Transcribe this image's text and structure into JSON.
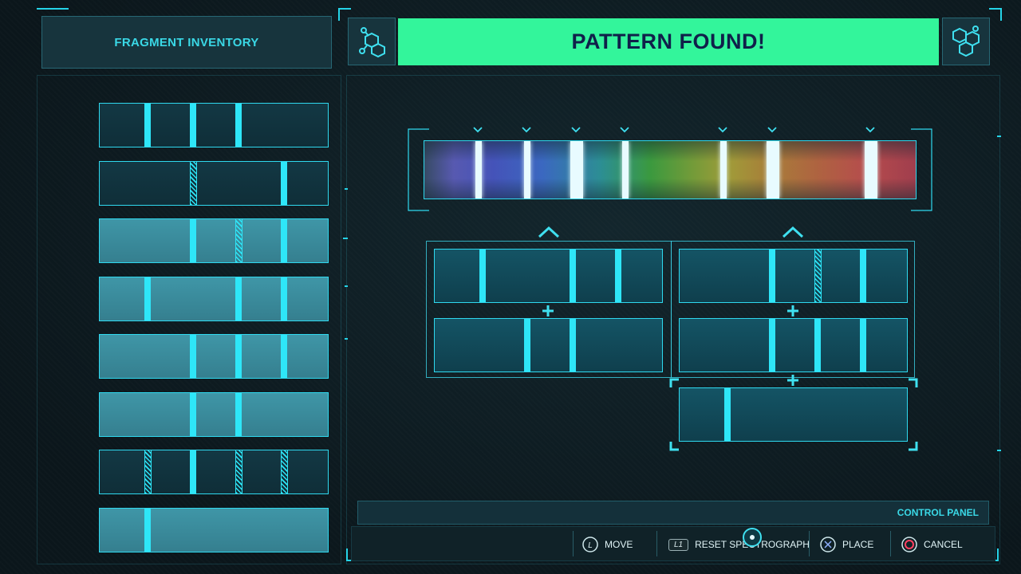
{
  "inventory": {
    "title": "FRAGMENT INVENTORY",
    "fragments": [
      {
        "style": "dim",
        "bands": [
          0.21,
          0.41,
          0.61
        ],
        "ghosts": [],
        "dividers": []
      },
      {
        "style": "dim",
        "bands": [
          0.81
        ],
        "ghosts": [
          0.41
        ],
        "dividers": []
      },
      {
        "style": "lit",
        "bands": [
          0.41,
          0.81
        ],
        "ghosts": [
          0.61
        ],
        "dividers": []
      },
      {
        "style": "lit",
        "bands": [
          0.21,
          0.61,
          0.81
        ],
        "ghosts": [],
        "dividers": []
      },
      {
        "style": "lit",
        "bands": [
          0.41,
          0.61,
          0.81
        ],
        "ghosts": [],
        "dividers": []
      },
      {
        "style": "lit",
        "bands": [
          0.41,
          0.61
        ],
        "ghosts": [],
        "dividers": []
      },
      {
        "style": "dim",
        "bands": [
          0.41
        ],
        "ghosts": [
          0.21,
          0.61,
          0.81
        ],
        "dividers": []
      },
      {
        "style": "lit",
        "bands": [
          0.21
        ],
        "ghosts": [],
        "dividers": []
      }
    ]
  },
  "banner": {
    "text": "PATTERN FOUND!",
    "color": "#33f59b"
  },
  "icons": {
    "left": "molecule-icon",
    "right": "molecule-icon"
  },
  "spectrograph": {
    "lines": [
      0.11,
      0.21,
      0.31,
      0.41,
      0.61,
      0.71,
      0.91
    ],
    "markers": [
      0.11,
      0.21,
      0.31,
      0.41,
      0.61,
      0.71,
      0.91
    ]
  },
  "assembly": {
    "left_column": [
      {
        "bands": [
          0.21,
          0.61,
          0.81
        ],
        "ghosts": []
      },
      {
        "bands": [
          0.41,
          0.61
        ],
        "ghosts": []
      }
    ],
    "right_column": [
      {
        "bands": [
          0.41,
          0.81
        ],
        "ghosts": [
          0.61
        ]
      },
      {
        "bands": [
          0.41,
          0.61,
          0.81
        ],
        "ghosts": []
      },
      {
        "bands": [
          0.21
        ],
        "ghosts": []
      }
    ]
  },
  "control_panel": {
    "title": "CONTROL PANEL",
    "controls": [
      {
        "button": "L",
        "label": "MOVE",
        "icon": "left-stick-icon"
      },
      {
        "button": "L1",
        "label": "RESET SPECTROGRAPH",
        "icon": "l1-button-icon"
      },
      {
        "button": "",
        "label": "PLACE",
        "icon": "cross-button-icon"
      },
      {
        "button": "",
        "label": "CANCEL",
        "icon": "circle-button-icon"
      }
    ]
  },
  "colors": {
    "accent": "#2fd9ef",
    "band": "#2ee6f8",
    "banner_text": "#10204a"
  }
}
